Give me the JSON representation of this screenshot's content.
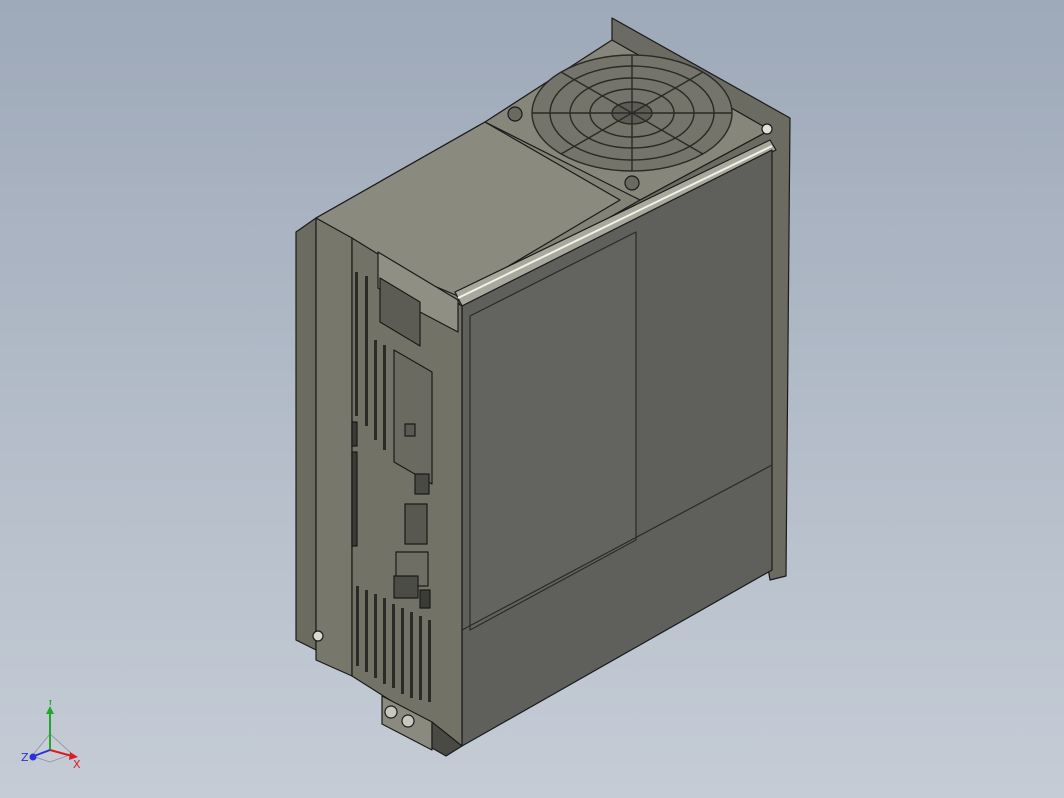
{
  "viewport": {
    "background_top": "#9ea9b9",
    "background_bottom": "#c5ccd6",
    "model_colors": {
      "front_face": "#5f5f5b",
      "top_face": "#828276",
      "side_face": "#6f6f64",
      "edge": "#1a1a1a",
      "highlight": "#e8e8e0"
    }
  },
  "triad": {
    "x_label": "X",
    "y_label": "Y",
    "z_label": "Z",
    "x_color": "#d62020",
    "y_color": "#1fa82a",
    "z_color": "#2a32d6"
  }
}
